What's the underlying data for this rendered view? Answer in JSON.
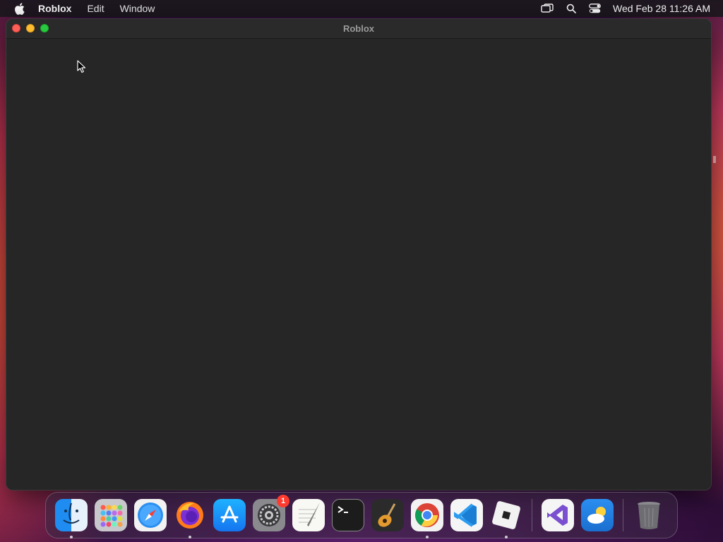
{
  "menubar": {
    "app_name": "Roblox",
    "items": [
      "Edit",
      "Window"
    ],
    "clock": "Wed Feb 28  11:26 AM",
    "status_icons": [
      "screen-mirroring-icon",
      "search-icon",
      "control-center-icon"
    ]
  },
  "window": {
    "title": "Roblox"
  },
  "dock": {
    "items": [
      {
        "name": "finder",
        "running": true
      },
      {
        "name": "launchpad",
        "running": false
      },
      {
        "name": "safari",
        "running": false
      },
      {
        "name": "firefox",
        "running": true
      },
      {
        "name": "app-store",
        "running": false
      },
      {
        "name": "system-settings",
        "running": false,
        "badge": "1"
      },
      {
        "name": "textedit",
        "running": false
      },
      {
        "name": "terminal",
        "running": false
      },
      {
        "name": "garageband",
        "running": false
      },
      {
        "name": "chrome",
        "running": true
      },
      {
        "name": "vscode",
        "running": false
      },
      {
        "name": "roblox",
        "running": true
      },
      {
        "name": "visual-studio",
        "running": false
      },
      {
        "name": "weather",
        "running": false
      },
      {
        "name": "trash",
        "running": false
      }
    ]
  },
  "colors": {
    "close": "#fe5f57",
    "minimize": "#febc2e",
    "maximize": "#28c840",
    "window_bg": "#262626",
    "badge": "#ff3b30"
  }
}
